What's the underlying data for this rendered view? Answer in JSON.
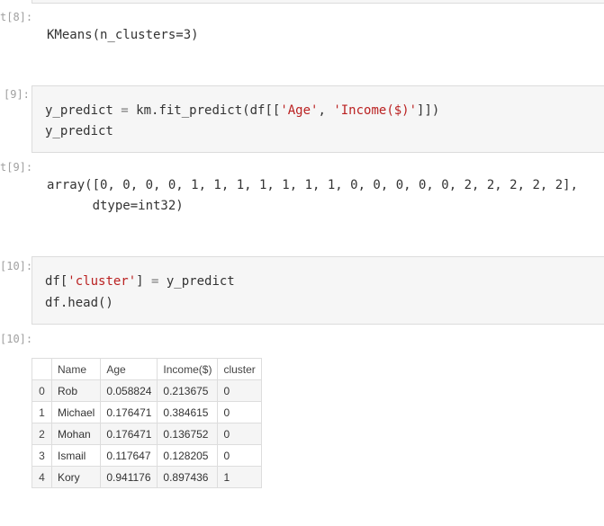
{
  "cells": {
    "out8": {
      "prompt": "t[8]:",
      "text": "KMeans(n_clusters=3)"
    },
    "in9": {
      "prompt": "[9]:",
      "line1_a": "y_predict ",
      "line1_op": "=",
      "line1_b": " km.fit_predict(df[[",
      "line1_s1": "'Age'",
      "line1_c": ", ",
      "line1_s2": "'Income($)'",
      "line1_d": "]])",
      "line2": "y_predict"
    },
    "out9": {
      "prompt": "t[9]:",
      "line1": "array([0, 0, 0, 0, 1, 1, 1, 1, 1, 1, 1, 0, 0, 0, 0, 0, 2, 2, 2, 2, 2],",
      "line2": "      dtype=int32)"
    },
    "in10": {
      "prompt": "[10]:",
      "line1_a": "df[",
      "line1_s": "'cluster'",
      "line1_b": "] ",
      "line1_op": "=",
      "line1_c": " y_predict",
      "line2": "df.head()"
    },
    "out10": {
      "prompt": "[10]:"
    }
  },
  "table": {
    "columns": [
      "",
      "Name",
      "Age",
      "Income($)",
      "cluster"
    ],
    "rows": [
      {
        "index": "0",
        "name": "Rob",
        "age": "0.058824",
        "income": "0.213675",
        "cluster": "0"
      },
      {
        "index": "1",
        "name": "Michael",
        "age": "0.176471",
        "income": "0.384615",
        "cluster": "0"
      },
      {
        "index": "2",
        "name": "Mohan",
        "age": "0.176471",
        "income": "0.136752",
        "cluster": "0"
      },
      {
        "index": "3",
        "name": "Ismail",
        "age": "0.117647",
        "income": "0.128205",
        "cluster": "0"
      },
      {
        "index": "4",
        "name": "Kory",
        "age": "0.941176",
        "income": "0.897436",
        "cluster": "1"
      }
    ]
  }
}
